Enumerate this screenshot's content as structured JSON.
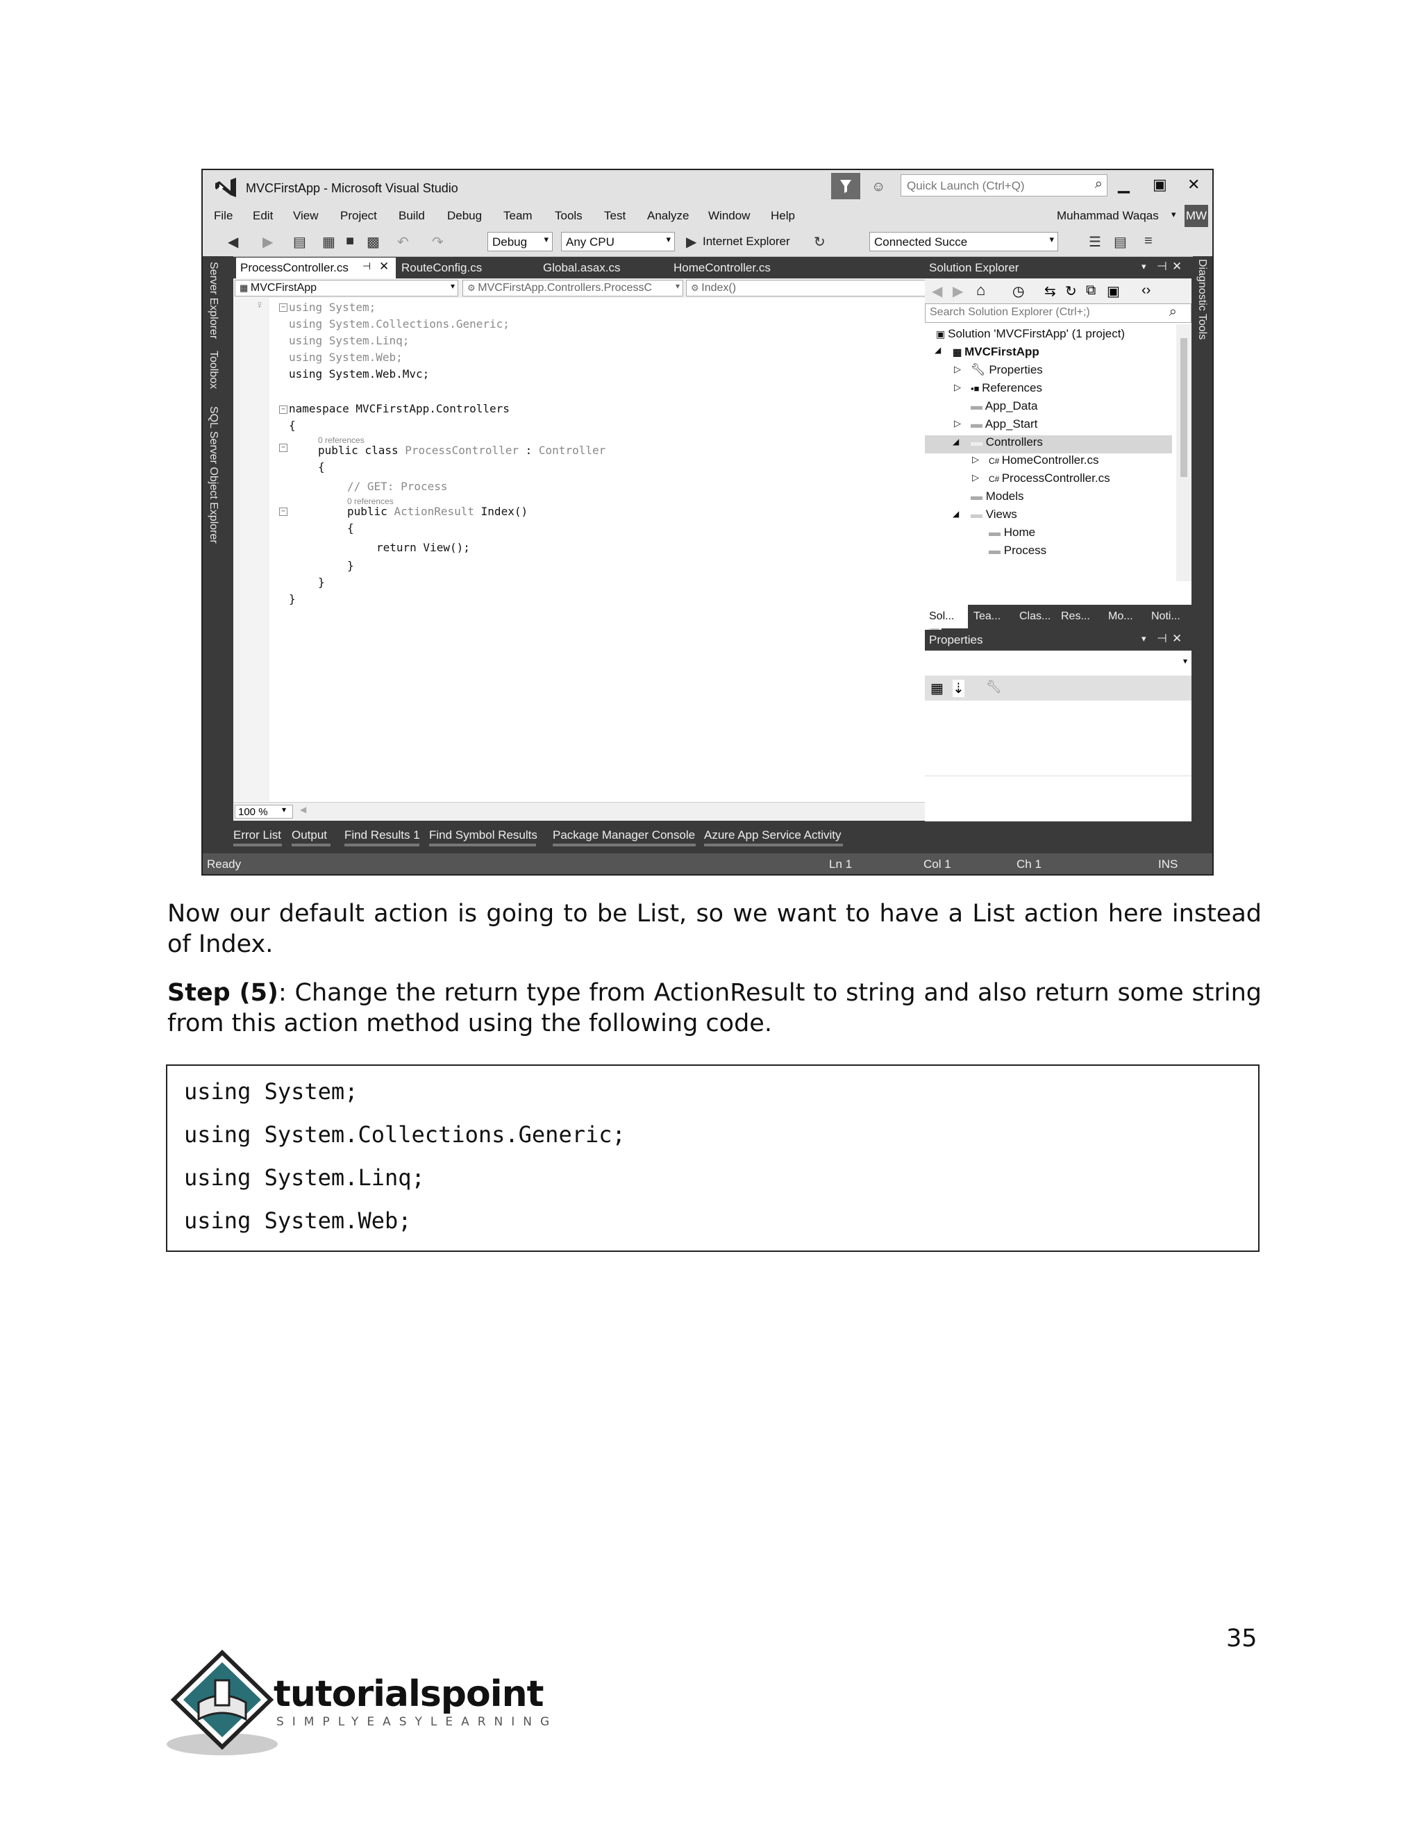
{
  "vs": {
    "title": "MVCFirstApp - Microsoft Visual Studio",
    "quick_launch_placeholder": "Quick Launch (Ctrl+Q)",
    "menu": [
      "File",
      "Edit",
      "View",
      "Project",
      "Build",
      "Debug",
      "Team",
      "Tools",
      "Test",
      "Analyze",
      "Window",
      "Help"
    ],
    "user": "Muhammad Waqas",
    "avatar": "MW",
    "toolbar": {
      "config": "Debug",
      "platform": "Any CPU",
      "browser": "Internet Explorer",
      "connected": "Connected Succe"
    },
    "left_tabs": [
      "Server Explorer",
      "Toolbox",
      "SQL Server Object Explorer"
    ],
    "right_tab": "Diagnostic Tools",
    "doc_tabs": [
      "ProcessController.cs",
      "RouteConfig.cs",
      "Global.asax.cs",
      "HomeController.cs"
    ],
    "nav": {
      "project": "MVCFirstApp",
      "class": "MVCFirstApp.Controllers.ProcessC",
      "member": "Index()"
    },
    "code": {
      "l1": "using System;",
      "l2": "using System.Collections.Generic;",
      "l3": "using System.Linq;",
      "l4": "using System.Web;",
      "l5": "using System.Web.Mvc;",
      "l6": "namespace MVCFirstApp.Controllers",
      "l7": "{",
      "ref1": "0 references",
      "l8a": "public class ",
      "l8b": "ProcessController",
      "l8c": " : ",
      "l8d": "Controller",
      "l9": "{",
      "l10": "// GET: Process",
      "ref2": "0 references",
      "l11a": "public ",
      "l11b": "ActionResult",
      "l11c": " Index()",
      "l12": "{",
      "l13": "return View();",
      "l14": "}",
      "l15": "}",
      "l16": "}"
    },
    "zoom": "100 %",
    "bottom_tabs": [
      "Error List",
      "Output",
      "Find Results 1",
      "Find Symbol Results",
      "Package Manager Console",
      "Azure App Service Activity"
    ],
    "status": {
      "ready": "Ready",
      "ln": "Ln 1",
      "col": "Col 1",
      "ch": "Ch 1",
      "ins": "INS"
    },
    "solution_explorer": {
      "title": "Solution Explorer",
      "search_placeholder": "Search Solution Explorer (Ctrl+;)",
      "items": [
        "Solution 'MVCFirstApp' (1 project)",
        "MVCFirstApp",
        "Properties",
        "References",
        "App_Data",
        "App_Start",
        "Controllers",
        "HomeController.cs",
        "ProcessController.cs",
        "Models",
        "Views",
        "Home",
        "Process"
      ],
      "tabs": [
        "Sol...",
        "Tea...",
        "Clas...",
        "Res...",
        "Mo...",
        "Noti..."
      ]
    },
    "properties_title": "Properties"
  },
  "doc": {
    "para1": "Now our default action is going to be List, so we want to have a List action here instead of Index.",
    "step_label": "Step (5)",
    "step_text": ": Change the return type from ActionResult to string and also return some string from this action method using the following code.",
    "code_lines": [
      "using System;",
      "using System.Collections.Generic;",
      "using System.Linq;",
      "using System.Web;"
    ],
    "page_number": "35",
    "logo_main": "tutorialspoint",
    "logo_sub": "SIMPLYEASYLEARNING"
  }
}
